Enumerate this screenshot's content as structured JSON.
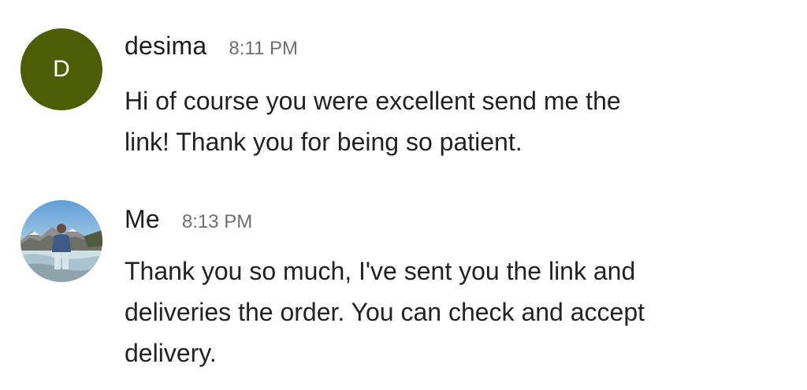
{
  "messages": [
    {
      "sender": "desima",
      "time": "8:11 PM",
      "avatar_letter": "D",
      "avatar_color": "#4b5e06",
      "text": "Hi of course you were excellent send me the\nlink! Thank you for being so patient."
    },
    {
      "sender": "Me",
      "time": "8:13 PM",
      "avatar_type": "photo",
      "text": "Thank you so much, I've sent you the link and\ndeliveries the order. You can check and accept\ndelivery."
    }
  ]
}
